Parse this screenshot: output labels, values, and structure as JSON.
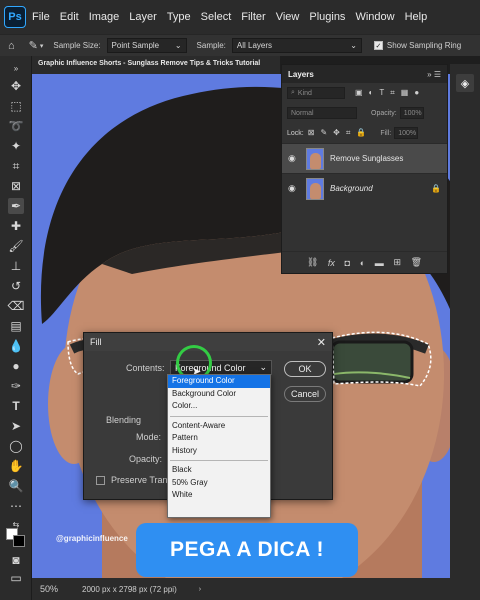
{
  "app": {
    "logo": "Ps"
  },
  "menu": {
    "items": [
      "File",
      "Edit",
      "Image",
      "Layer",
      "Type",
      "Select",
      "Filter",
      "View",
      "Plugins",
      "Window",
      "Help"
    ]
  },
  "options": {
    "sample_size_label": "Sample Size:",
    "sample_size_value": "Point Sample",
    "sample_label": "Sample:",
    "sample_value": "All Layers",
    "sampling_ring_label": "Show Sampling Ring"
  },
  "document": {
    "tab_title": "Graphic Influence Shorts - Sunglass Remove Tips & Tricks Tutorial"
  },
  "status": {
    "zoom": "50%",
    "info": "2000 px x 2798 px (72 ppi)"
  },
  "layers_panel": {
    "tab": "Layers",
    "search_placeholder": "Kind",
    "blend_mode": "Normal",
    "opacity_label": "Opacity:",
    "opacity_value": "100%",
    "lock_label": "Lock:",
    "fill_label": "Fill:",
    "fill_value": "100%",
    "layers": [
      {
        "name": "Remove Sunglasses"
      },
      {
        "name": "Background"
      }
    ]
  },
  "fill_dialog": {
    "title": "Fill",
    "contents_label": "Contents:",
    "contents_value": "Foreground Color",
    "ok_label": "OK",
    "cancel_label": "Cancel",
    "blending_label": "Blending",
    "mode_label": "Mode:",
    "opacity_label": "Opacity:",
    "preserve_label": "Preserve Transparency",
    "options": [
      [
        "Foreground Color",
        "Background Color",
        "Color..."
      ],
      [
        "Content-Aware",
        "Pattern",
        "History"
      ],
      [
        "Black",
        "50% Gray",
        "White"
      ]
    ]
  },
  "overlay": {
    "banner": "PEGA A DICA !",
    "watermark": "@graphicinfluence"
  },
  "colors": {
    "accent": "#1473e6",
    "canvas_bg": "#5f7be0",
    "banner": "#2f8ff2",
    "cursor_ring": "#33cc44"
  }
}
